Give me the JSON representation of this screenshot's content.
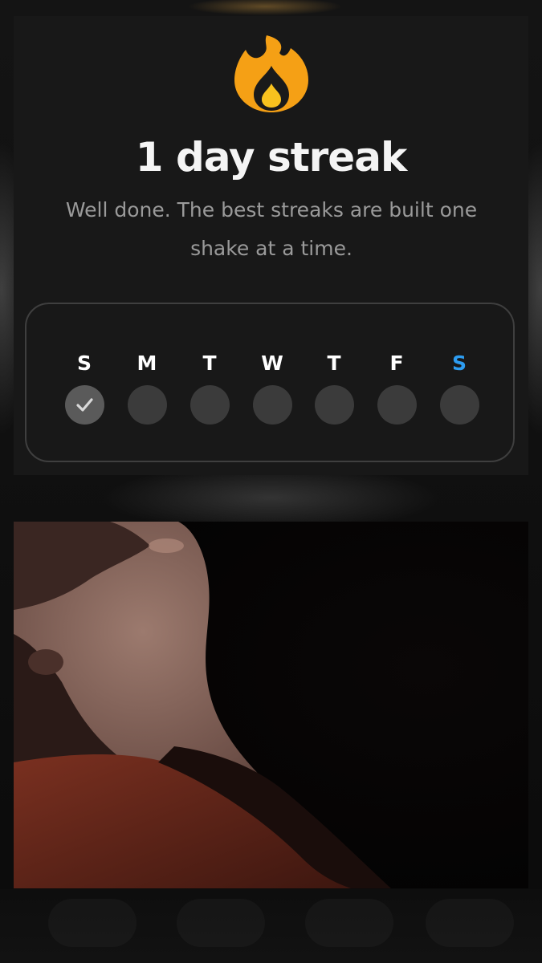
{
  "streak": {
    "title": "1 day streak",
    "subtitle": "Well done. The best streaks are built one shake at a time.",
    "icon": "fire-icon",
    "flame_colors": {
      "outer": "#F5A015",
      "inner": "#F8C21E",
      "core": "#1A1A1A"
    }
  },
  "week": {
    "days": [
      {
        "label": "S",
        "completed": true,
        "today": false
      },
      {
        "label": "M",
        "completed": false,
        "today": false
      },
      {
        "label": "T",
        "completed": false,
        "today": false
      },
      {
        "label": "W",
        "completed": false,
        "today": false
      },
      {
        "label": "T",
        "completed": false,
        "today": false
      },
      {
        "label": "F",
        "completed": false,
        "today": false
      },
      {
        "label": "S",
        "completed": false,
        "today": true
      }
    ],
    "today_color": "#2D9CF0",
    "check_icon": "check-icon"
  },
  "media": {
    "type": "video-frame"
  }
}
